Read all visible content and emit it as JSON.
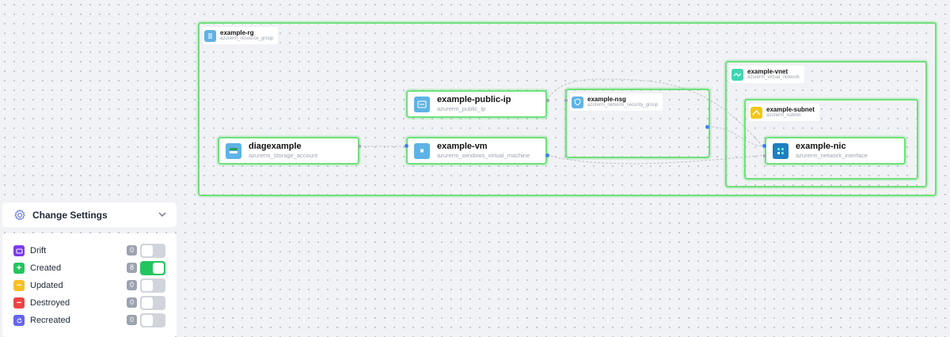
{
  "resource_group": {
    "name": "example-rg",
    "type": "azurerm_resource_group"
  },
  "vnet_group": {
    "name": "example-vnet",
    "type": "azurerm_virtual_network"
  },
  "subnet_group": {
    "name": "example-subnet",
    "type": "azurerm_subnet"
  },
  "nsg_group": {
    "name": "example-nsg",
    "type": "azurerm_network_security_group"
  },
  "nodes": {
    "public_ip": {
      "name": "example-public-ip",
      "type": "azurerm_public_ip"
    },
    "storage": {
      "name": "diagexample",
      "type": "azurerm_storage_account"
    },
    "vm": {
      "name": "example-vm",
      "type": "azurerm_windows_virtual_machine"
    },
    "nic": {
      "name": "example-nic",
      "type": "azurerm_network_interface"
    }
  },
  "settings": {
    "label": "Change Settings"
  },
  "legend": [
    {
      "label": "Drift",
      "count": "0",
      "enabled": false,
      "color": "#7c3aed",
      "icon": "drift-icon"
    },
    {
      "label": "Created",
      "count": "8",
      "enabled": true,
      "color": "#22c55e",
      "icon": "plus-icon"
    },
    {
      "label": "Updated",
      "count": "0",
      "enabled": false,
      "color": "#fbbf24",
      "icon": "tilde-icon"
    },
    {
      "label": "Destroyed",
      "count": "0",
      "enabled": false,
      "color": "#ef4444",
      "icon": "minus-icon"
    },
    {
      "label": "Recreated",
      "count": "0",
      "enabled": false,
      "color": "#6366f1",
      "icon": "refresh-icon"
    }
  ]
}
